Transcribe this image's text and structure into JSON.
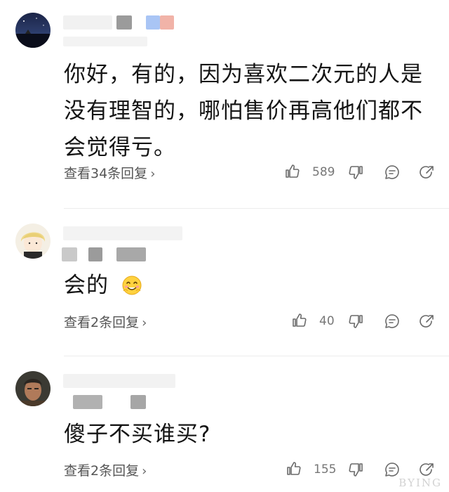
{
  "comments": [
    {
      "text": "你好，有的，因为喜欢二次元的人是没有理智的，哪怕售价再高他们都不会觉得亏。",
      "reply_link": "查看34条回复",
      "likes": "589"
    },
    {
      "text": "会的",
      "emoji": "smile-emoji",
      "reply_link": "查看2条回复",
      "likes": "40"
    },
    {
      "text": "傻子不买谁买?",
      "reply_link": "查看2条回复",
      "likes": "155"
    }
  ],
  "icons": {
    "like": "thumbs-up-icon",
    "dislike": "thumbs-down-icon",
    "comment": "comment-icon",
    "share": "share-icon",
    "chevron": "chevron-right-icon"
  },
  "colors": {
    "text": "#151515",
    "secondary": "#555555",
    "icon": "#6a6a6a",
    "divider": "#ececec"
  },
  "watermark": "BYING"
}
